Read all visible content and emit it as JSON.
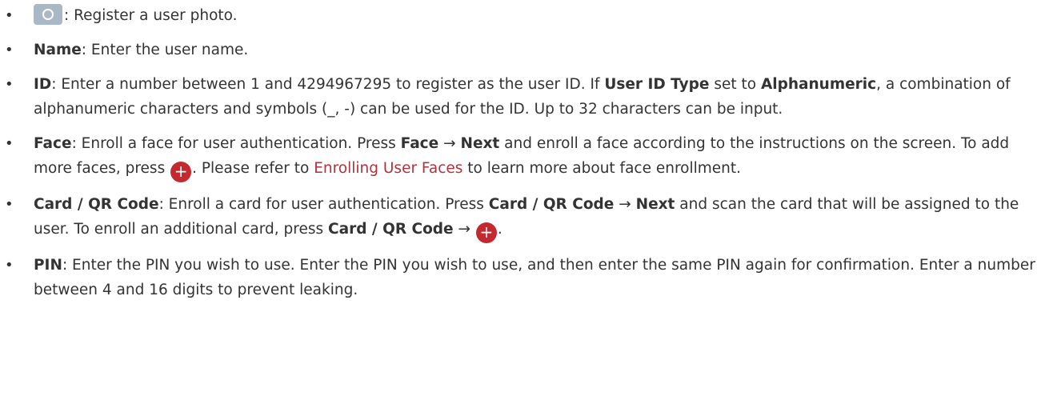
{
  "bullet": "•",
  "items": [
    {
      "camera_tail": ": Register a user photo."
    },
    {
      "label": "Name",
      "text": ": Enter the user name."
    },
    {
      "label": "ID",
      "text_a": ": Enter a number between 1 and 4294967295 to register as the user ID. If ",
      "bold_a": "User ID Type",
      "text_b": " set to ",
      "bold_b": "Alphanumeric",
      "text_c": ", a combination of alphanumeric characters and symbols (_, -) can be used for the ID. Up to 32 characters can be input."
    },
    {
      "label": "Face",
      "text_a": ": Enroll a face for user authentication. Press ",
      "bold_a": "Face",
      "arrow": " → ",
      "bold_b": "Next",
      "text_b": " and enroll a face according to the instructions on the screen. To add more faces, press ",
      "plus": "+",
      "text_c": ". Please refer to ",
      "link": "Enrolling User Faces",
      "text_d": " to learn more about face enrollment."
    },
    {
      "label": "Card / QR Code",
      "text_a": ": Enroll a card for user authentication. Press ",
      "bold_a": "Card / QR Code",
      "arrow": " → ",
      "bold_b": "Next",
      "text_b": " and scan the card that will be assigned to the user. To enroll an additional card, press ",
      "bold_c": "Card / QR Code",
      "arrow2": " → ",
      "plus": "+",
      "text_c": "."
    },
    {
      "label": "PIN",
      "text": ": Enter the PIN you wish to use. Enter the PIN you wish to use, and then enter the same PIN again for confirmation. Enter a number between 4 and 16 digits to prevent leaking."
    }
  ],
  "colors": {
    "text": "#333333",
    "camera_icon_bg": "#a9b8c6",
    "plus_icon_bg": "#c3292f",
    "link": "#b0333c"
  },
  "icons": [
    "camera-icon",
    "plus-circle-icon"
  ]
}
